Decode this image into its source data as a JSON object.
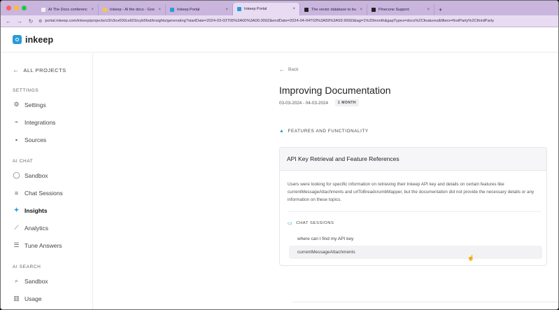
{
  "browser": {
    "tabs": [
      {
        "title": "AI The Docs conference",
        "favicon_color": "#f2f2f2",
        "active": false
      },
      {
        "title": "Inkeep - AI the docs - Goog",
        "favicon_color": "#f3c64b",
        "active": false
      },
      {
        "title": "Inkeep Portal",
        "favicon_color": "#2a9bd8",
        "active": false
      },
      {
        "title": "Inkeep Portal",
        "favicon_color": "#2a9bd8",
        "active": true
      },
      {
        "title": "The vector database to buil",
        "favicon_color": "#222222",
        "active": false
      },
      {
        "title": "Pinecone Support",
        "favicon_color": "#222222",
        "active": false
      }
    ],
    "new_tab": "+",
    "url": "portal.inkeep.com/inkeep/projects/cl1h3ov000cs601tcyb5fod/insights/generating?startDate=2024-03-03T05%3A00%3A00.000Z&endDate=2024-04-04T03%3A59%3A59.999Z&tag=1%20month&gapTypes=docs%2Cfeatures&filters=firstParty%2CthirdParty"
  },
  "header": {
    "logo_text": "inkeep"
  },
  "sidebar": {
    "back_label": "ALL PROJECTS",
    "sections": [
      {
        "title": "SETTINGS",
        "items": [
          {
            "label": "Settings",
            "icon": "gear-icon"
          },
          {
            "label": "Integrations",
            "icon": "plug-icon"
          },
          {
            "label": "Sources",
            "icon": "database-icon"
          }
        ]
      },
      {
        "title": "AI CHAT",
        "items": [
          {
            "label": "Sandbox",
            "icon": "chat-bubble-icon"
          },
          {
            "label": "Chat Sessions",
            "icon": "list-icon"
          },
          {
            "label": "Insights",
            "icon": "wand-icon",
            "active": true
          },
          {
            "label": "Analytics",
            "icon": "trend-icon"
          },
          {
            "label": "Tune Answers",
            "icon": "sliders-icon"
          }
        ]
      },
      {
        "title": "AI SEARCH",
        "items": [
          {
            "label": "Sandbox",
            "icon": "search-icon"
          },
          {
            "label": "Usage",
            "icon": "bar-chart-icon"
          }
        ]
      }
    ]
  },
  "main": {
    "back_label": "Back",
    "title": "Improving Documentation",
    "date_range": "03-03-2024 - 04-03-2024",
    "period_badge": "1 MONTH",
    "section_heading": "FEATURES AND FUNCTIONALITY",
    "card": {
      "title": "API Key Retrieval and Feature References",
      "description": "Users were looking for specific information on retrieving their Inkeep API key and details on certain features like currentMessageAttachments and urlToBreadcrumbMapper, but the documentation did not provide the necessary details or any information on these topics.",
      "sessions_heading": "CHAT SESSIONS",
      "sessions": [
        "where can I find my API key",
        "currentMessageAttachments"
      ]
    }
  },
  "colors": {
    "tabstrip": "#c9b5de",
    "accent": "#2a9bd8"
  }
}
